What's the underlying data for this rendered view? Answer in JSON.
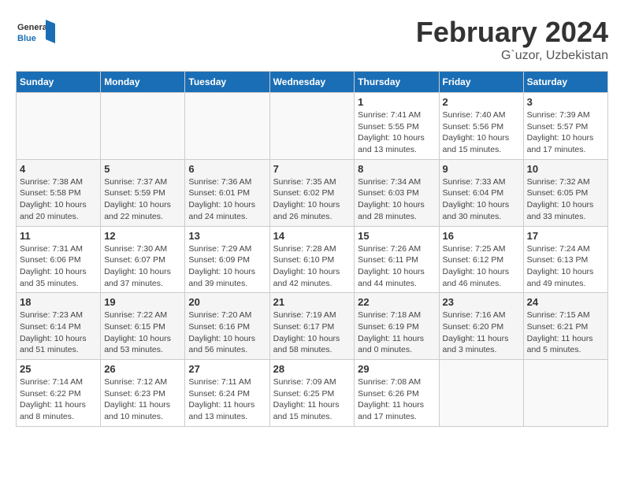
{
  "header": {
    "logo_general": "General",
    "logo_blue": "Blue",
    "month_title": "February 2024",
    "location": "G`uzor, Uzbekistan"
  },
  "days_of_week": [
    "Sunday",
    "Monday",
    "Tuesday",
    "Wednesday",
    "Thursday",
    "Friday",
    "Saturday"
  ],
  "weeks": [
    {
      "days": [
        {
          "num": "",
          "info": ""
        },
        {
          "num": "",
          "info": ""
        },
        {
          "num": "",
          "info": ""
        },
        {
          "num": "",
          "info": ""
        },
        {
          "num": "1",
          "info": "Sunrise: 7:41 AM\nSunset: 5:55 PM\nDaylight: 10 hours\nand 13 minutes."
        },
        {
          "num": "2",
          "info": "Sunrise: 7:40 AM\nSunset: 5:56 PM\nDaylight: 10 hours\nand 15 minutes."
        },
        {
          "num": "3",
          "info": "Sunrise: 7:39 AM\nSunset: 5:57 PM\nDaylight: 10 hours\nand 17 minutes."
        }
      ]
    },
    {
      "days": [
        {
          "num": "4",
          "info": "Sunrise: 7:38 AM\nSunset: 5:58 PM\nDaylight: 10 hours\nand 20 minutes."
        },
        {
          "num": "5",
          "info": "Sunrise: 7:37 AM\nSunset: 5:59 PM\nDaylight: 10 hours\nand 22 minutes."
        },
        {
          "num": "6",
          "info": "Sunrise: 7:36 AM\nSunset: 6:01 PM\nDaylight: 10 hours\nand 24 minutes."
        },
        {
          "num": "7",
          "info": "Sunrise: 7:35 AM\nSunset: 6:02 PM\nDaylight: 10 hours\nand 26 minutes."
        },
        {
          "num": "8",
          "info": "Sunrise: 7:34 AM\nSunset: 6:03 PM\nDaylight: 10 hours\nand 28 minutes."
        },
        {
          "num": "9",
          "info": "Sunrise: 7:33 AM\nSunset: 6:04 PM\nDaylight: 10 hours\nand 30 minutes."
        },
        {
          "num": "10",
          "info": "Sunrise: 7:32 AM\nSunset: 6:05 PM\nDaylight: 10 hours\nand 33 minutes."
        }
      ]
    },
    {
      "days": [
        {
          "num": "11",
          "info": "Sunrise: 7:31 AM\nSunset: 6:06 PM\nDaylight: 10 hours\nand 35 minutes."
        },
        {
          "num": "12",
          "info": "Sunrise: 7:30 AM\nSunset: 6:07 PM\nDaylight: 10 hours\nand 37 minutes."
        },
        {
          "num": "13",
          "info": "Sunrise: 7:29 AM\nSunset: 6:09 PM\nDaylight: 10 hours\nand 39 minutes."
        },
        {
          "num": "14",
          "info": "Sunrise: 7:28 AM\nSunset: 6:10 PM\nDaylight: 10 hours\nand 42 minutes."
        },
        {
          "num": "15",
          "info": "Sunrise: 7:26 AM\nSunset: 6:11 PM\nDaylight: 10 hours\nand 44 minutes."
        },
        {
          "num": "16",
          "info": "Sunrise: 7:25 AM\nSunset: 6:12 PM\nDaylight: 10 hours\nand 46 minutes."
        },
        {
          "num": "17",
          "info": "Sunrise: 7:24 AM\nSunset: 6:13 PM\nDaylight: 10 hours\nand 49 minutes."
        }
      ]
    },
    {
      "days": [
        {
          "num": "18",
          "info": "Sunrise: 7:23 AM\nSunset: 6:14 PM\nDaylight: 10 hours\nand 51 minutes."
        },
        {
          "num": "19",
          "info": "Sunrise: 7:22 AM\nSunset: 6:15 PM\nDaylight: 10 hours\nand 53 minutes."
        },
        {
          "num": "20",
          "info": "Sunrise: 7:20 AM\nSunset: 6:16 PM\nDaylight: 10 hours\nand 56 minutes."
        },
        {
          "num": "21",
          "info": "Sunrise: 7:19 AM\nSunset: 6:17 PM\nDaylight: 10 hours\nand 58 minutes."
        },
        {
          "num": "22",
          "info": "Sunrise: 7:18 AM\nSunset: 6:19 PM\nDaylight: 11 hours\nand 0 minutes."
        },
        {
          "num": "23",
          "info": "Sunrise: 7:16 AM\nSunset: 6:20 PM\nDaylight: 11 hours\nand 3 minutes."
        },
        {
          "num": "24",
          "info": "Sunrise: 7:15 AM\nSunset: 6:21 PM\nDaylight: 11 hours\nand 5 minutes."
        }
      ]
    },
    {
      "days": [
        {
          "num": "25",
          "info": "Sunrise: 7:14 AM\nSunset: 6:22 PM\nDaylight: 11 hours\nand 8 minutes."
        },
        {
          "num": "26",
          "info": "Sunrise: 7:12 AM\nSunset: 6:23 PM\nDaylight: 11 hours\nand 10 minutes."
        },
        {
          "num": "27",
          "info": "Sunrise: 7:11 AM\nSunset: 6:24 PM\nDaylight: 11 hours\nand 13 minutes."
        },
        {
          "num": "28",
          "info": "Sunrise: 7:09 AM\nSunset: 6:25 PM\nDaylight: 11 hours\nand 15 minutes."
        },
        {
          "num": "29",
          "info": "Sunrise: 7:08 AM\nSunset: 6:26 PM\nDaylight: 11 hours\nand 17 minutes."
        },
        {
          "num": "",
          "info": ""
        },
        {
          "num": "",
          "info": ""
        }
      ]
    }
  ]
}
